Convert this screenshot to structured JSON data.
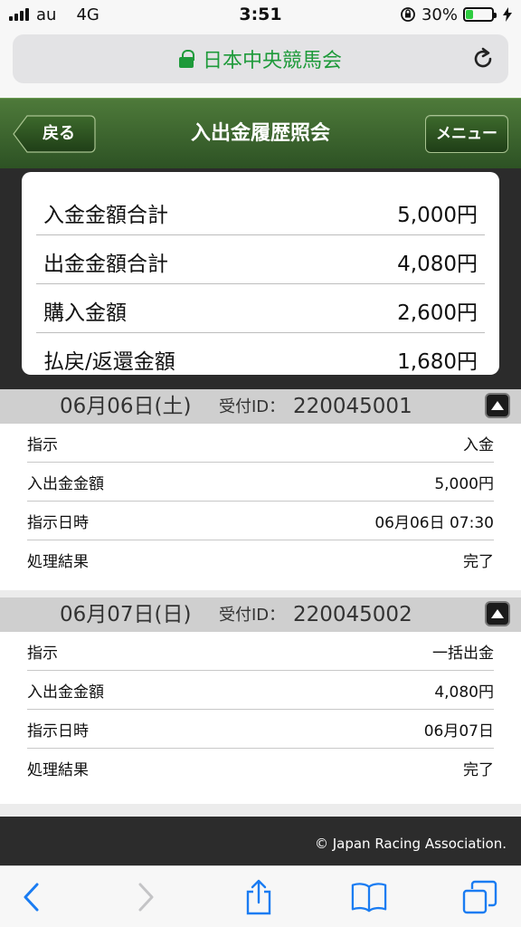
{
  "status_bar": {
    "carrier": "au",
    "network": "4G",
    "time": "3:51",
    "battery": "30%",
    "battery_level": 0.3
  },
  "address_bar": {
    "site": "日本中央競馬会"
  },
  "header": {
    "back_label": "戻る",
    "title": "入出金履歴照会",
    "menu_label": "メニュー"
  },
  "summary": [
    {
      "label": "入金金額合計",
      "value": "5,000円"
    },
    {
      "label": "出金金額合計",
      "value": "4,080円"
    },
    {
      "label": "購入金額",
      "value": "2,600円"
    },
    {
      "label": "払戻/返還金額",
      "value": "1,680円"
    }
  ],
  "records": [
    {
      "date": "06月06日(土)",
      "id_label": "受付ID：",
      "id": "220045001",
      "rows": [
        {
          "label": "指示",
          "value": "入金"
        },
        {
          "label": "入出金金額",
          "value": "5,000円"
        },
        {
          "label": "指示日時",
          "value": "06月06日 07:30"
        },
        {
          "label": "処理結果",
          "value": "完了"
        }
      ]
    },
    {
      "date": "06月07日(日)",
      "id_label": "受付ID：",
      "id": "220045002",
      "rows": [
        {
          "label": "指示",
          "value": "一括出金"
        },
        {
          "label": "入出金金額",
          "value": "4,080円"
        },
        {
          "label": "指示日時",
          "value": "06月07日"
        },
        {
          "label": "処理結果",
          "value": "完了"
        }
      ]
    }
  ],
  "footer": {
    "copyright": "© Japan Racing Association."
  },
  "colors": {
    "header_green": "#3a6a2c",
    "secure_green": "#1e9a3a",
    "ios_blue": "#1a7cf2"
  }
}
